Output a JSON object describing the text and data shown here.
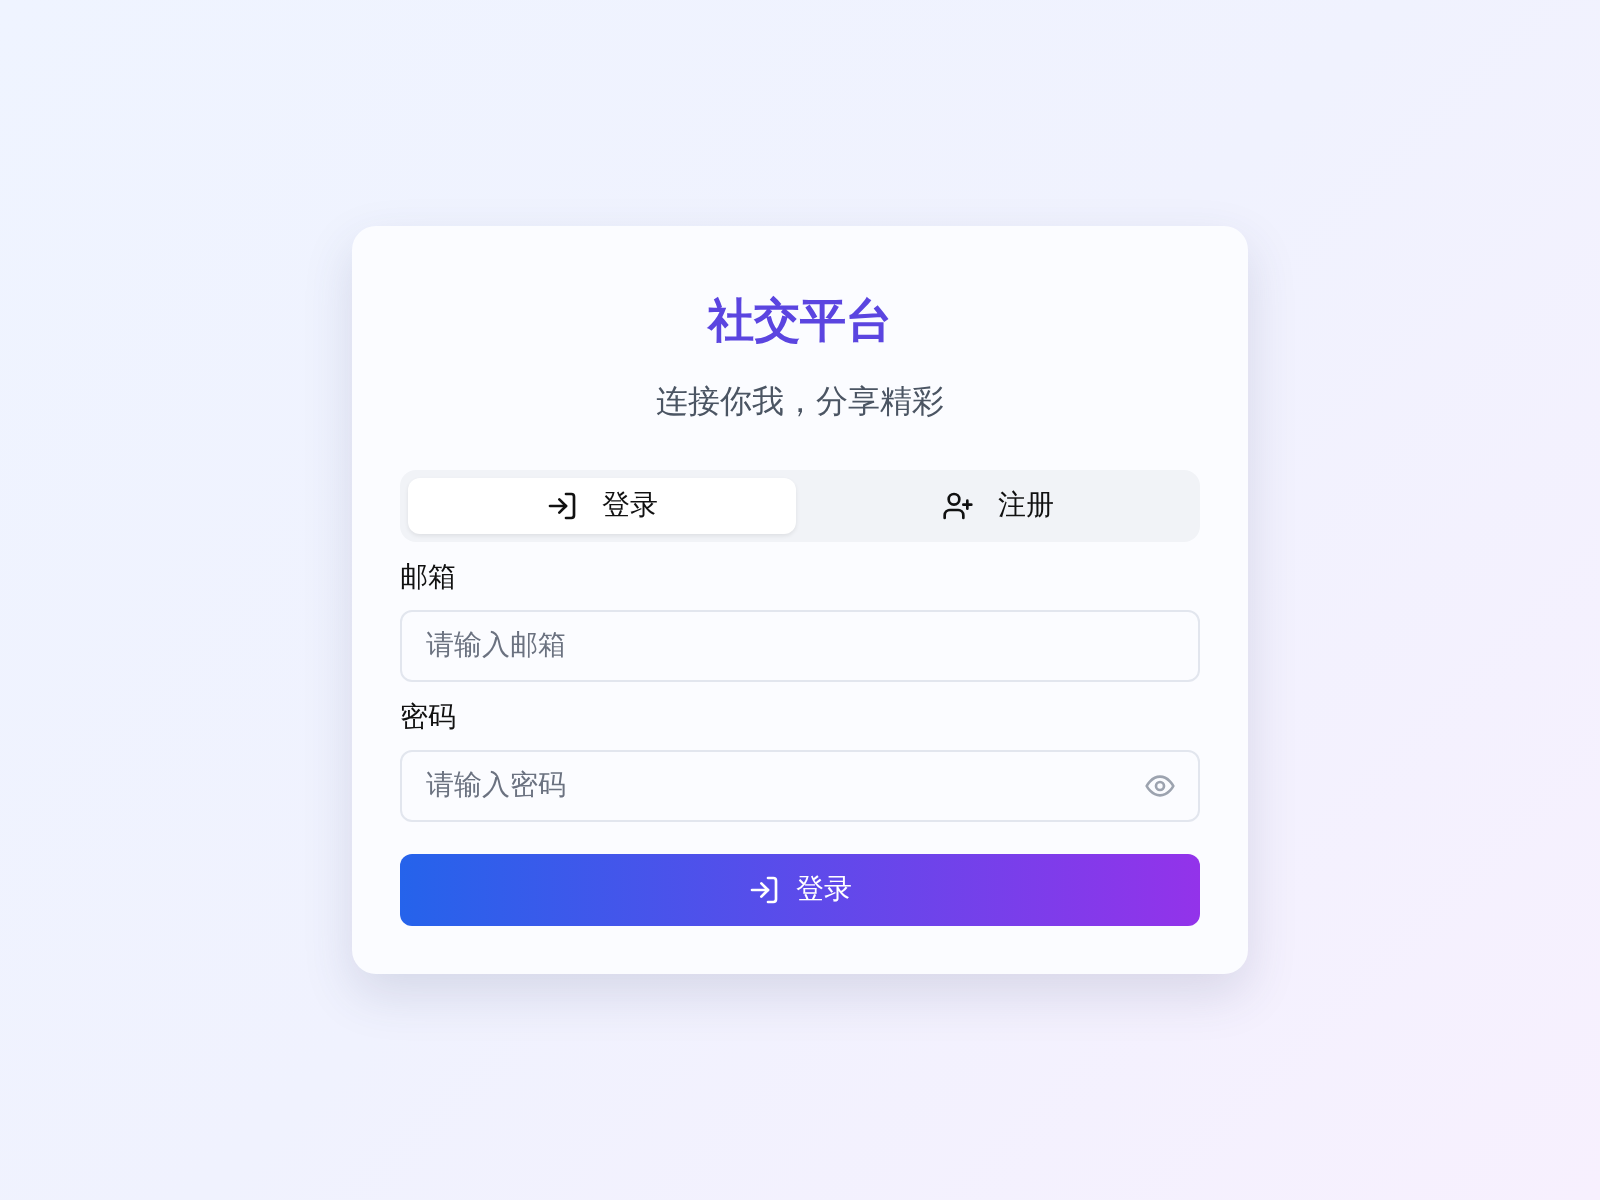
{
  "title": "社交平台",
  "subtitle": "连接你我，分享精彩",
  "tabs": [
    {
      "label": "登录",
      "kind": "login",
      "selected": true
    },
    {
      "label": "注册",
      "kind": "register",
      "selected": false
    }
  ],
  "fields": [
    {
      "label": "邮箱",
      "placeholder": "请输入邮箱",
      "kind": "text"
    },
    {
      "label": "密码",
      "placeholder": "请输入密码",
      "kind": "password"
    }
  ],
  "submit": {
    "label": "登录",
    "kind": "login"
  }
}
